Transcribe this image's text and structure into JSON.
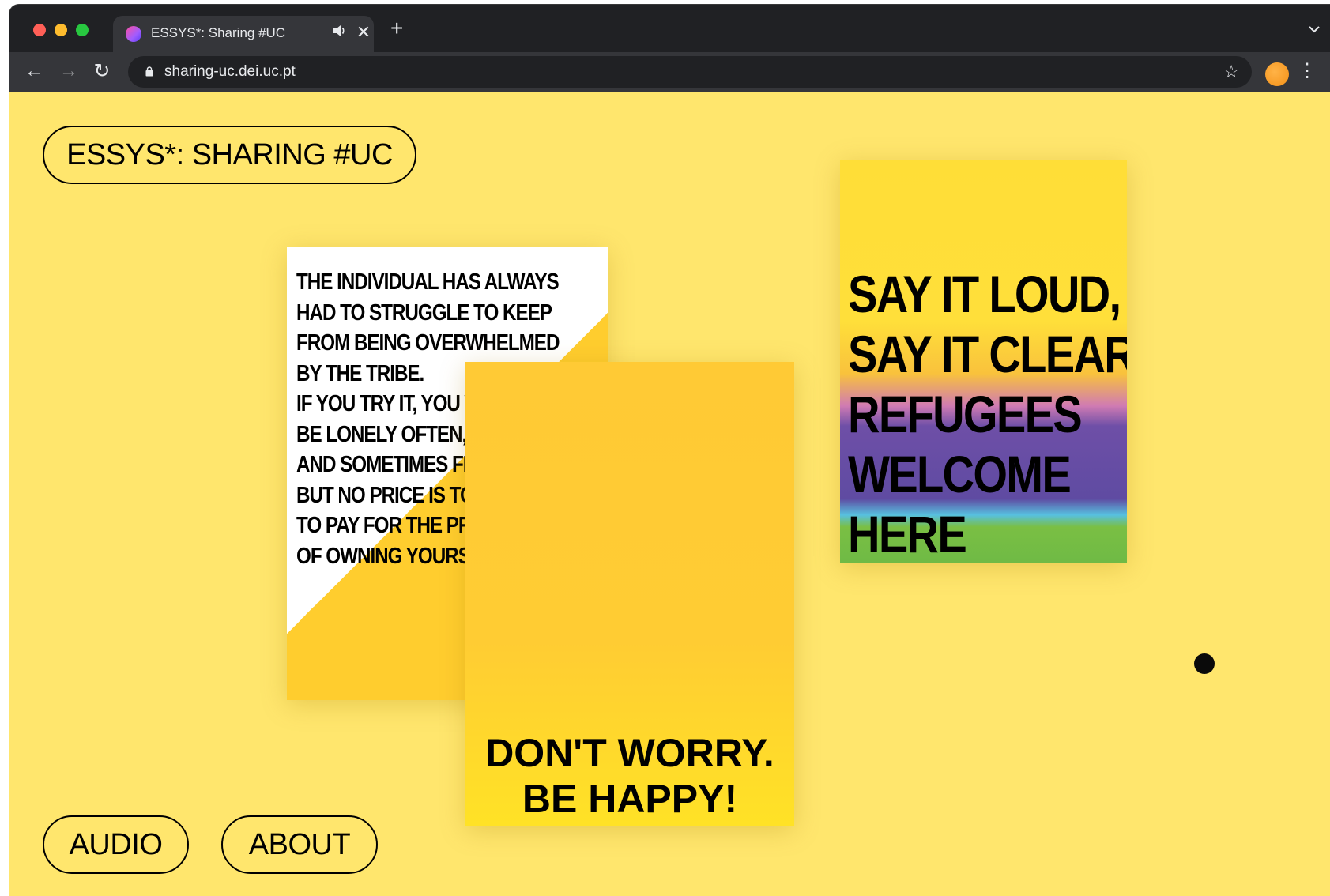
{
  "browser": {
    "tab": {
      "title": "ESSYS*: Sharing #UC",
      "audio_icon": "speaker-icon",
      "close_glyph": "✕"
    },
    "new_tab_glyph": "+",
    "tab_dropdown_glyph": "⌄",
    "nav": {
      "back_glyph": "←",
      "forward_glyph": "→",
      "reload_glyph": "↻"
    },
    "url": "sharing-uc.dei.uc.pt",
    "star_glyph": "☆",
    "menu_glyph": "⋮"
  },
  "page": {
    "title": "ESSYS*: SHARING #UC",
    "footer_buttons": {
      "audio": "AUDIO",
      "about": "ABOUT"
    },
    "posters": {
      "individual": "THE INDIVIDUAL HAS ALWAYS\nHAD TO STRUGGLE TO KEEP\nFROM BEING OVERWHELMED\nBY THE TRIBE.\nIF YOU TRY IT, YOU WILL\nBE LONELY OFTEN,\nAND SOMETIMES FRIGHTENED.\nBUT NO PRICE IS TOO HIGH\nTO PAY FOR THE PRIVILEGE\nOF OWNING YOURSELF.",
      "dont_worry": "DON'T WORRY.\nBE HAPPY!",
      "refugees": "SAY IT LOUD,\nSAY IT CLEAR\nREFUGEES\nWELCOME\nHERE"
    }
  },
  "colors": {
    "page_background": "#ffe66d",
    "chrome_dark": "#202124",
    "chrome_toolbar": "#35363a"
  }
}
